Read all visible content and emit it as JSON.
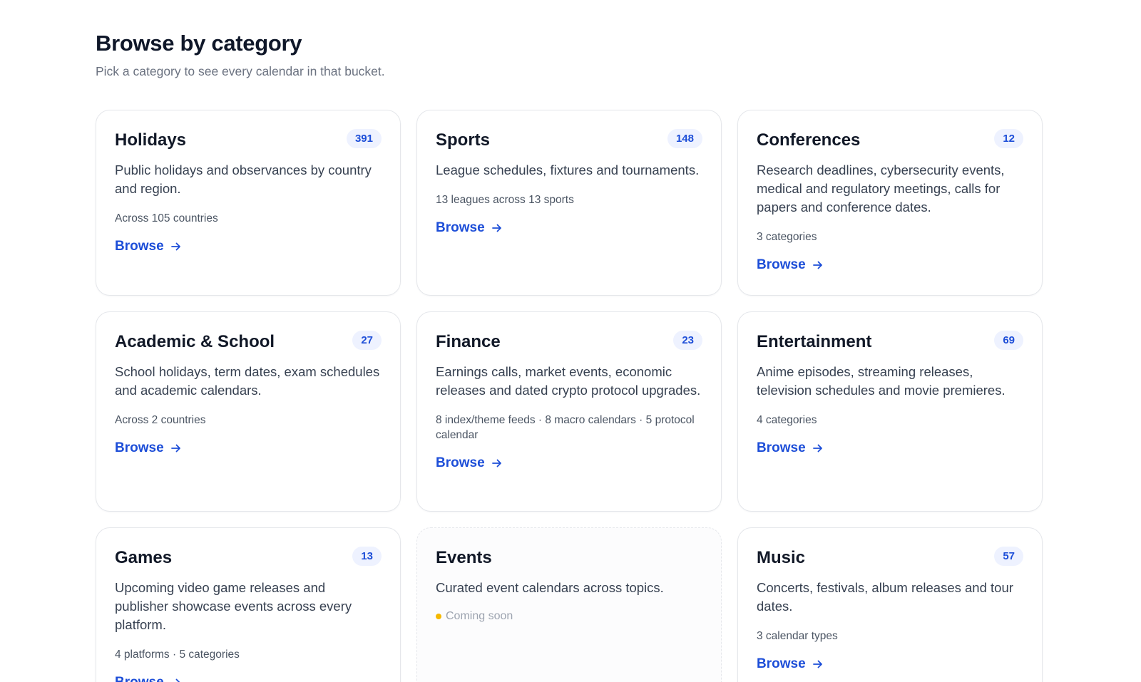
{
  "header": {
    "title": "Browse by category",
    "subtitle": "Pick a category to see every calendar in that bucket."
  },
  "colors": {
    "accent": "#1d4ed8",
    "badge_bg": "#eef2ff",
    "coming_soon_dot": "#f5b800"
  },
  "icons": {
    "browse_arrow": "arrow-right-icon",
    "status_dot": "status-dot-icon"
  },
  "cards": [
    {
      "title": "Holidays",
      "count": "391",
      "description": "Public holidays and observances by country and region.",
      "meta": "Across 105 countries",
      "link": "Browse"
    },
    {
      "title": "Sports",
      "count": "148",
      "description": "League schedules, fixtures and tournaments.",
      "meta": "13 leagues across 13 sports",
      "link": "Browse"
    },
    {
      "title": "Conferences",
      "count": "12",
      "description": "Research deadlines, cybersecurity events, medical and regulatory meetings, calls for papers and conference dates.",
      "meta": "3 categories",
      "link": "Browse"
    },
    {
      "title": "Academic & School",
      "count": "27",
      "description": "School holidays, term dates, exam schedules and academic calendars.",
      "meta": "Across 2 countries",
      "link": "Browse"
    },
    {
      "title": "Finance",
      "count": "23",
      "description": "Earnings calls, market events, economic releases and dated crypto protocol upgrades.",
      "meta": "8 index/theme feeds · 8 macro calendars · 5 protocol calendar",
      "link": "Browse"
    },
    {
      "title": "Entertainment",
      "count": "69",
      "description": "Anime episodes, streaming releases, television schedules and movie premieres.",
      "meta": "4 categories",
      "link": "Browse"
    },
    {
      "title": "Games",
      "count": "13",
      "description": "Upcoming video game releases and publisher showcase events across every platform.",
      "meta": "4 platforms · 5 categories",
      "link": "Browse"
    },
    {
      "title": "Events",
      "description": "Curated event calendars across topics.",
      "status": "Coming soon"
    },
    {
      "title": "Music",
      "count": "57",
      "description": "Concerts, festivals, album releases and tour dates.",
      "meta": "3 calendar types",
      "link": "Browse"
    }
  ]
}
